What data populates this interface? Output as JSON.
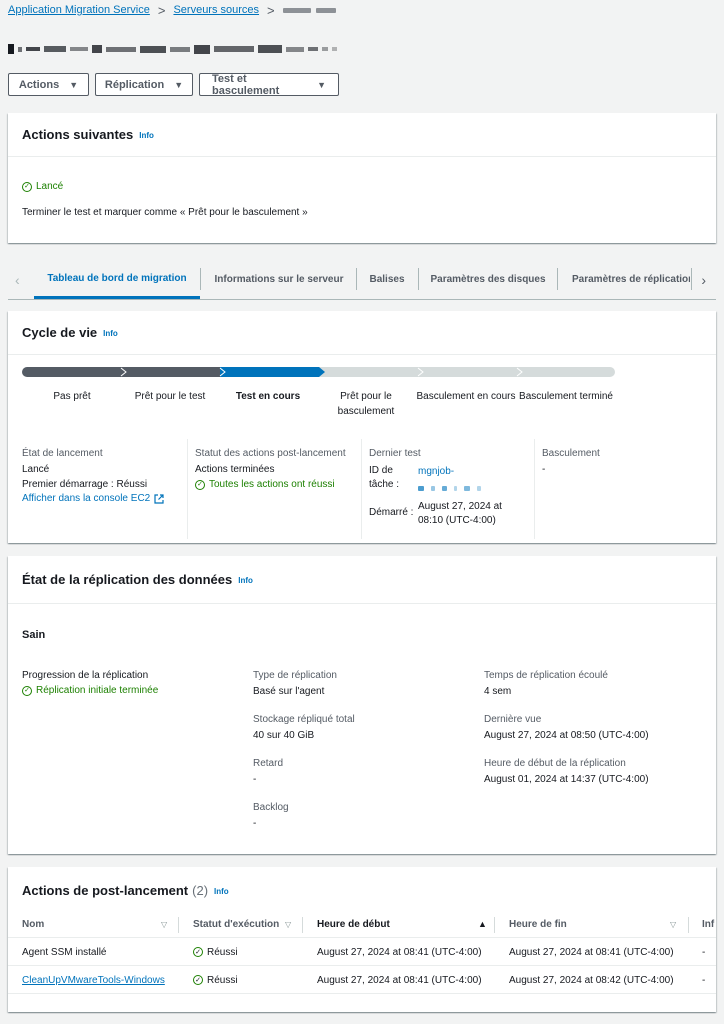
{
  "breadcrumb": {
    "items": [
      "Application Migration Service",
      "Serveurs sources"
    ],
    "separator": ">"
  },
  "buttons": {
    "actions": "Actions",
    "replication": "Réplication",
    "test_cutover": "Test et basculement"
  },
  "next_actions": {
    "title": "Actions suivantes",
    "info": "Info",
    "status": "Lancé",
    "message": "Terminer le test et marquer comme « Prêt pour le basculement »"
  },
  "tabs": [
    "Tableau de bord de migration",
    "Informations sur le serveur",
    "Balises",
    "Paramètres des disques",
    "Paramètres de réplication"
  ],
  "lifecycle": {
    "title": "Cycle de vie",
    "info": "Info",
    "stages": [
      "Pas prêt",
      "Prêt pour le test",
      "Test en cours",
      "Prêt pour le basculement",
      "Basculement en cours",
      "Basculement terminé"
    ],
    "current_stage": "Test en cours",
    "launch_state_label": "État de lancement",
    "launch_state_value": "Lancé",
    "first_boot": "Premier démarrage : Réussi",
    "ec2_link": "Afficher dans la console EC2",
    "post_launch_label": "Statut des actions post-lancement",
    "post_launch_value": "Actions terminées",
    "post_launch_ok": "Toutes les actions ont réussi",
    "last_test_label": "Dernier test",
    "task_id_label": "ID de tâche :",
    "task_id_value": "mgnjob-",
    "started_label": "Démarré :",
    "started_value": "August 27, 2024 at 08:10 (UTC-4:00)",
    "cutover_label": "Basculement",
    "cutover_value": "-"
  },
  "replication": {
    "title": "État de la réplication des données",
    "info": "Info",
    "health": "Sain",
    "progress_label": "Progression de la réplication",
    "progress_value": "Réplication initiale terminée",
    "type_label": "Type de réplication",
    "type_value": "Basé sur l'agent",
    "storage_label": "Stockage répliqué total",
    "storage_value": "40 sur 40 GiB",
    "lag_label": "Retard",
    "lag_value": "-",
    "backlog_label": "Backlog",
    "backlog_value": "-",
    "elapsed_label": "Temps de réplication écoulé",
    "elapsed_value": "4 sem",
    "last_seen_label": "Dernière vue",
    "last_seen_value": "August 27, 2024 at 08:50 (UTC-4:00)",
    "start_label": "Heure de début de la réplication",
    "start_value": "August 01, 2024 at 14:37 (UTC-4:00)"
  },
  "post_launch": {
    "title": "Actions de post-lancement",
    "count": "(2)",
    "info": "Info",
    "columns": [
      "Nom",
      "Statut d'exécution",
      "Heure de début",
      "Heure de fin",
      "Inf"
    ],
    "rows": [
      {
        "name": "Agent SSM installé",
        "status": "Réussi",
        "start": "August 27, 2024 at 08:41 (UTC-4:00)",
        "end": "August 27, 2024 at 08:41 (UTC-4:00)",
        "extra": "-"
      },
      {
        "name": "CleanUpVMwareTools-Windows",
        "status": "Réussi",
        "start": "August 27, 2024 at 08:41 (UTC-4:00)",
        "end": "August 27, 2024 at 08:42 (UTC-4:00)",
        "extra": "-"
      }
    ]
  },
  "colors": {
    "accent": "#0073bb",
    "success": "#1d8102",
    "lifecycle_done": "#545b64",
    "lifecycle_current": "#0073bb",
    "lifecycle_pending": "#d5dbdb"
  }
}
